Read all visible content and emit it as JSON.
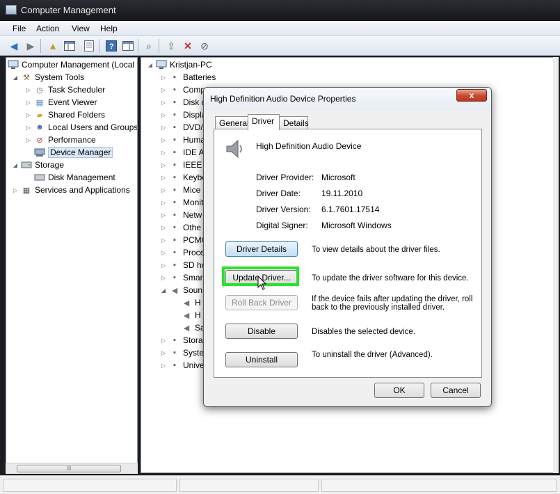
{
  "window": {
    "title": "Computer Management"
  },
  "menu": [
    "File",
    "Action",
    "View",
    "Help"
  ],
  "toolbar_icons": [
    "back-arrow-icon",
    "forward-arrow-icon",
    "up-folder-icon",
    "show-hide-tree-icon",
    "properties-icon",
    "help-icon",
    "show-hide-action-pane-icon",
    "scan-hardware-icon",
    "update-driver-icon",
    "uninstall-device-icon",
    "disable-device-icon"
  ],
  "left_tree": {
    "root": "Computer Management (Local",
    "system_tools": "System Tools",
    "task_scheduler": "Task Scheduler",
    "event_viewer": "Event Viewer",
    "shared_folders": "Shared Folders",
    "local_users": "Local Users and Groups",
    "performance": "Performance",
    "device_manager": "Device Manager",
    "storage": "Storage",
    "disk_management": "Disk Management",
    "services": "Services and Applications"
  },
  "right_tree": {
    "root": "Kristjan-PC",
    "items": [
      "Batteries",
      "Comp",
      "Disk d",
      "Displa",
      "DVD/",
      "Huma",
      "IDE A",
      "IEEE 1",
      "Keybo",
      "Mice",
      "Monit",
      "Netw",
      "Othe",
      "PCMC",
      "Proce",
      "SD ho",
      "Smar",
      "Soun",
      "H",
      "H",
      "Sa",
      "Stora",
      "Syste",
      "Unive"
    ]
  },
  "dialog": {
    "title": "High Definition Audio Device Properties",
    "close_label": "x",
    "tabs": [
      "General",
      "Driver",
      "Details"
    ],
    "device_name": "High Definition Audio Device",
    "props": [
      {
        "label": "Driver Provider:",
        "value": "Microsoft"
      },
      {
        "label": "Driver Date:",
        "value": "19.11.2010"
      },
      {
        "label": "Driver Version:",
        "value": "6.1.7601.17514"
      },
      {
        "label": "Digital Signer:",
        "value": "Microsoft Windows"
      }
    ],
    "buttons": {
      "details": "Driver Details",
      "details_desc": "To view details about the driver files.",
      "update": "Update Driver...",
      "update_desc": "To update the driver software for this device.",
      "rollback": "Roll Back Driver",
      "rollback_desc": "If the device fails after updating the driver, roll back to the previously installed driver.",
      "disable": "Disable",
      "disable_desc": "Disables the selected device.",
      "uninstall": "Uninstall",
      "uninstall_desc": "To uninstall the driver (Advanced).",
      "ok": "OK",
      "cancel": "Cancel"
    }
  },
  "scroll_thumb_label": "III",
  "colors": {
    "highlight": "#27e32a",
    "selection": "#dde8f5"
  }
}
